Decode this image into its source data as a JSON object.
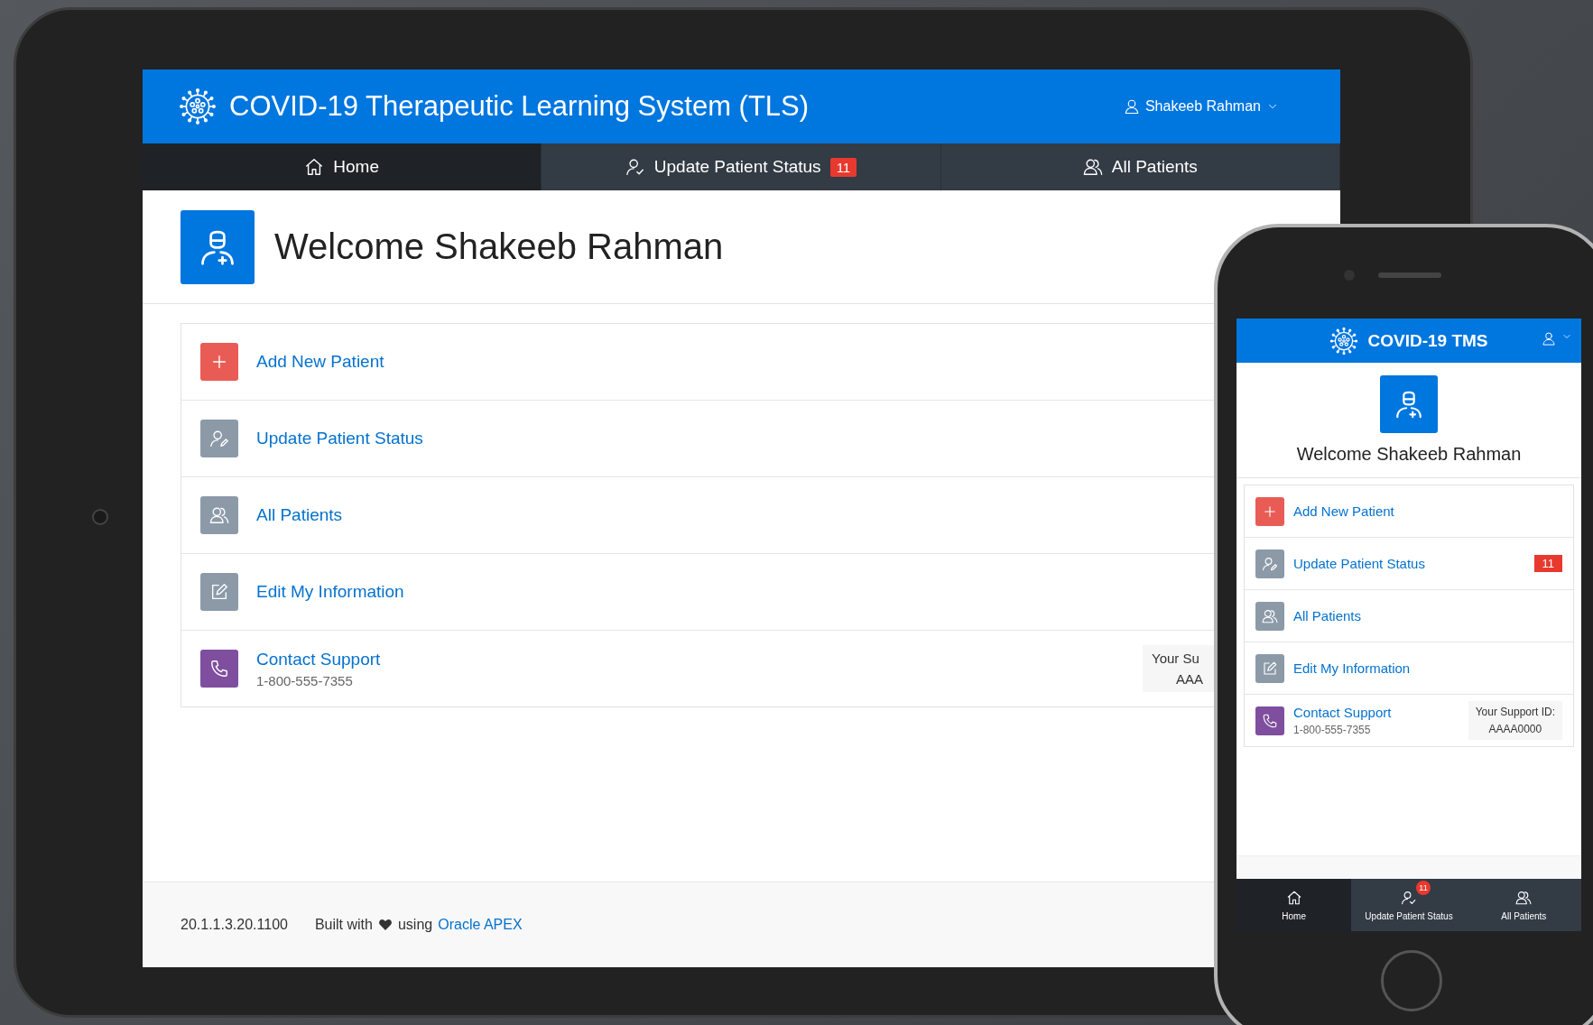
{
  "tablet": {
    "header": {
      "title": "COVID-19 Therapeutic Learning System (TLS)",
      "user": "Shakeeb Rahman"
    },
    "tabs": [
      {
        "kind": "home",
        "label": "Home",
        "selected": true
      },
      {
        "kind": "status",
        "label": "Update Patient Status",
        "selected": false,
        "badge": "11"
      },
      {
        "kind": "patients",
        "label": "All Patients",
        "selected": false
      }
    ],
    "welcome": "Welcome Shakeeb Rahman",
    "menu": [
      {
        "kind": "add",
        "label": "Add New Patient",
        "color": "#e85c55"
      },
      {
        "kind": "status",
        "label": "Update Patient Status",
        "color": "#8c9aa8"
      },
      {
        "kind": "patients",
        "label": "All Patients",
        "color": "#8c9aa8"
      },
      {
        "kind": "edit",
        "label": "Edit My Information",
        "color": "#8c9aa8"
      },
      {
        "kind": "support",
        "label": "Contact Support",
        "subtitle": "1-800-555-7355",
        "color": "#7f4e9e",
        "support_label": "Your Su",
        "support_id": "AAA"
      }
    ],
    "footer": {
      "version": "20.1.1.3.20.1100",
      "built_with": "Built with",
      "using": "using",
      "link": "Oracle APEX"
    }
  },
  "phone": {
    "header": {
      "title": "COVID-19 TMS"
    },
    "welcome": "Welcome Shakeeb Rahman",
    "menu": [
      {
        "kind": "add",
        "label": "Add New Patient",
        "color": "#e85c55"
      },
      {
        "kind": "status",
        "label": "Update Patient Status",
        "color": "#8c9aa8",
        "badge": "11"
      },
      {
        "kind": "patients",
        "label": "All Patients",
        "color": "#8c9aa8"
      },
      {
        "kind": "edit",
        "label": "Edit My Information",
        "color": "#8c9aa8"
      },
      {
        "kind": "support",
        "label": "Contact Support",
        "subtitle": "1-800-555-7355",
        "color": "#7f4e9e",
        "support_label": "Your Support ID:",
        "support_id": "AAAA0000"
      }
    ],
    "tabs": [
      {
        "kind": "home",
        "label": "Home",
        "selected": true
      },
      {
        "kind": "status",
        "label": "Update Patient Status",
        "selected": false,
        "badge": "11"
      },
      {
        "kind": "patients",
        "label": "All Patients",
        "selected": false
      }
    ]
  }
}
